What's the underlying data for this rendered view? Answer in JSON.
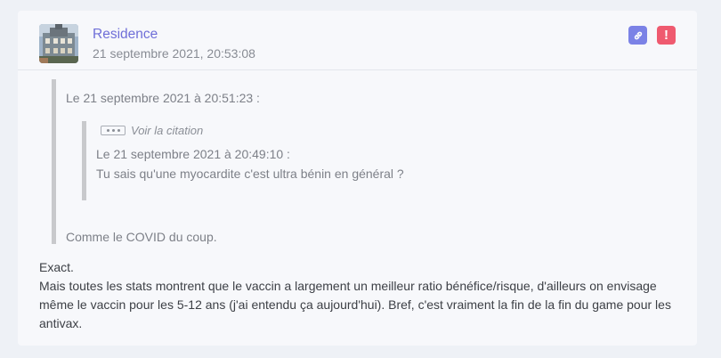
{
  "post": {
    "author": "Residence",
    "date": "21 septembre 2021, 20:53:08",
    "actions": {
      "link_icon": "link-icon",
      "report_icon": "exclamation-icon",
      "report_label": "!",
      "link_color": "#7b82e6",
      "report_color": "#ef5a6f"
    },
    "quote": {
      "header": "Le 21 septembre 2021 à 20:51:23 :",
      "nested": {
        "toggle_label": "Voir la citation",
        "header": "Le 21 septembre 2021 à 20:49:10 :",
        "text": "Tu sais qu'une myocardite c'est ultra bénin en général ?"
      },
      "text": "Comme le COVID du coup."
    },
    "body": [
      "Exact.",
      "Mais toutes les stats montrent que le vaccin a largement un meilleur ratio bénéfice/risque, d'ailleurs on envisage même le vaccin pour les 5-12 ans (j'ai entendu ça aujourd'hui). Bref, c'est vraiment la fin de la fin du game pour les antivax."
    ]
  }
}
